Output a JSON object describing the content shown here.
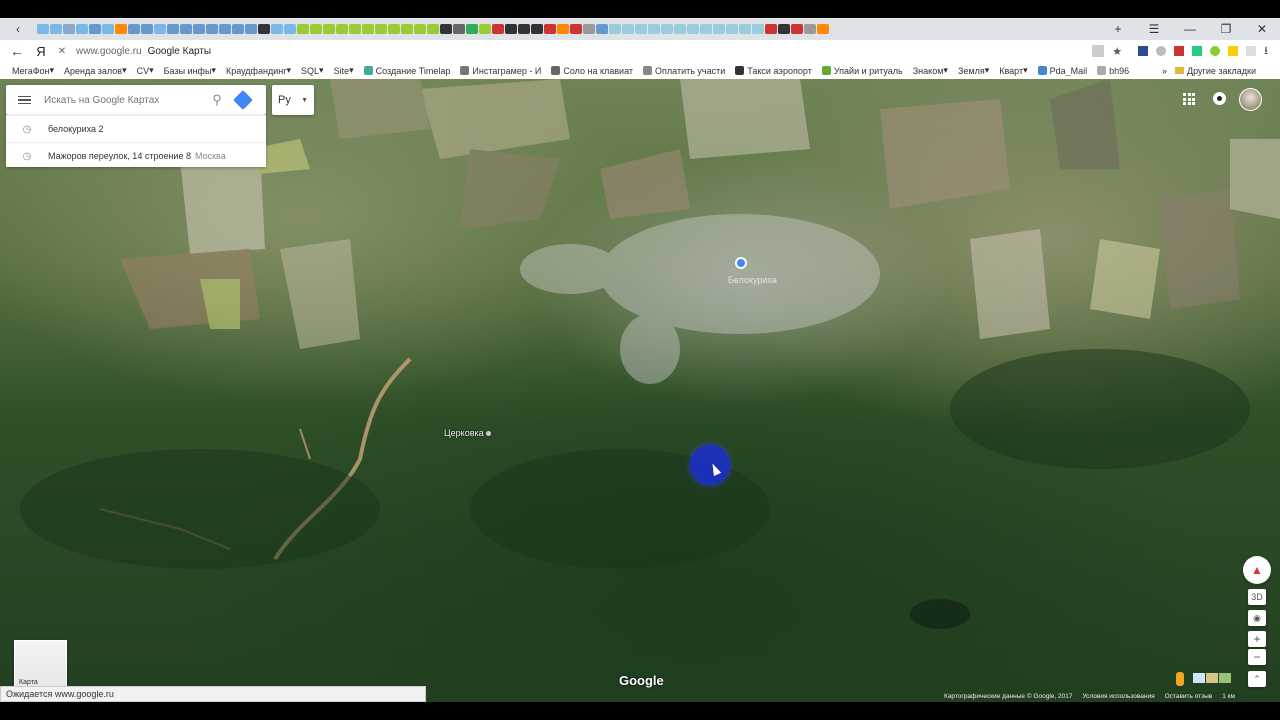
{
  "browser": {
    "address": {
      "domain": "www.google.ru",
      "title": "Google Карты"
    },
    "yandex_logo": "Я",
    "bookmarks": [
      {
        "label": "МегаФон",
        "dropdown": true
      },
      {
        "label": "Аренда залов",
        "dropdown": true
      },
      {
        "label": "CV",
        "dropdown": true
      },
      {
        "label": "Базы инфы",
        "dropdown": true
      },
      {
        "label": "Краудфандинг",
        "dropdown": true
      },
      {
        "label": "SQL",
        "dropdown": true
      },
      {
        "label": "Site",
        "dropdown": true
      },
      {
        "label": "Создание Timelap",
        "dropdown": false
      },
      {
        "label": "Инстаграмер - И",
        "dropdown": false
      },
      {
        "label": "Соло на клавиат",
        "dropdown": false
      },
      {
        "label": "Оплатить участи",
        "dropdown": false
      },
      {
        "label": "Такси аэропорт",
        "dropdown": false
      },
      {
        "label": "Упайи и ритуаль",
        "dropdown": false
      },
      {
        "label": "Знаком",
        "dropdown": true
      },
      {
        "label": "Земля",
        "dropdown": true
      },
      {
        "label": "Кварт",
        "dropdown": true
      },
      {
        "label": "Pda_Mail",
        "dropdown": false
      },
      {
        "label": "bh96",
        "dropdown": false
      }
    ],
    "other_bookmarks": "Другие закладки",
    "status": "Ожидается www.google.ru",
    "window_controls": {
      "minimize": "—",
      "restore": "❐",
      "close": "✕",
      "menu": "☰"
    }
  },
  "maps": {
    "search": {
      "placeholder": "Искать на Google Картах"
    },
    "language": "Ру",
    "history": [
      {
        "text": "белокуриха 2",
        "suffix": ""
      },
      {
        "text": "Мажоров переулок, 14 строение 8",
        "suffix": "Москва"
      }
    ],
    "place_label": "Церковка",
    "city_label": "Белокуриха",
    "layer_label": "Карта",
    "logo": "Google",
    "controls": {
      "tilt": "3D",
      "zoom_in": "+",
      "zoom_out": "−",
      "expand": "⌃"
    },
    "footer": {
      "copyright": "Картографические данные © Google, 2017",
      "terms": "Условия использования",
      "feedback": "Оставить отзыв",
      "scale": "1 км"
    }
  },
  "colors": {
    "accent": "#4285f4",
    "location_dot": "#1a2fd0",
    "tabstrip": "#dfe3e8"
  }
}
